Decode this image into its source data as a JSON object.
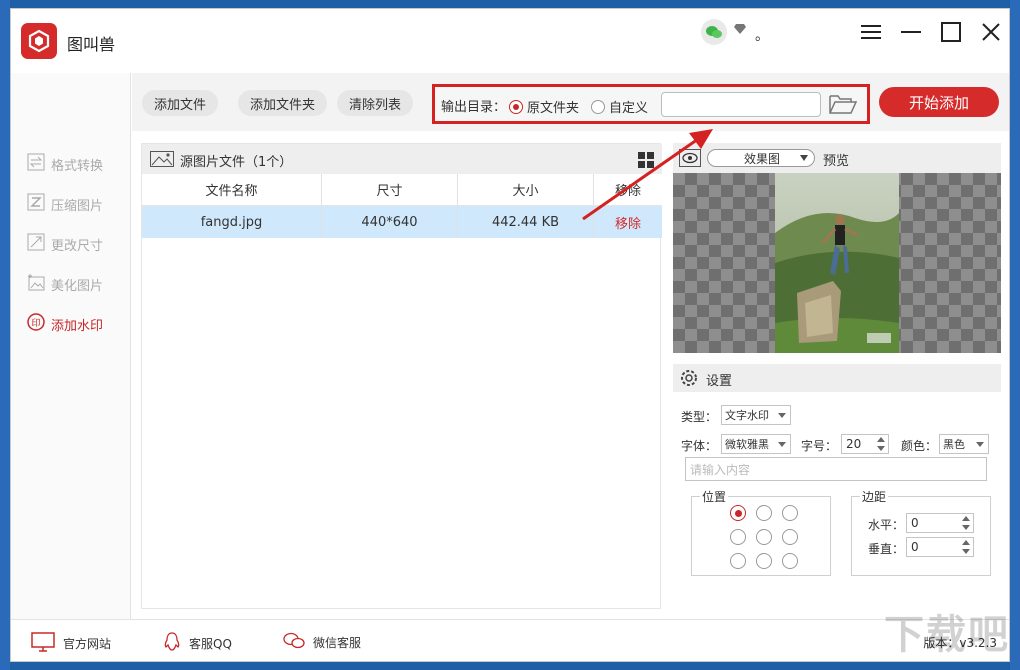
{
  "app": {
    "title": "图叫兽"
  },
  "account": {
    "suffix": "。"
  },
  "sidebar": {
    "items": [
      {
        "label": "格式转换",
        "icon": "swap-icon"
      },
      {
        "label": "压缩图片",
        "icon": "compress-icon"
      },
      {
        "label": "更改尺寸",
        "icon": "resize-icon"
      },
      {
        "label": "美化图片",
        "icon": "beautify-icon"
      },
      {
        "label": "添加水印",
        "icon": "stamp-icon",
        "active": true
      }
    ]
  },
  "toolbar": {
    "add_file": "添加文件",
    "add_folder": "添加文件夹",
    "clear_list": "清除列表",
    "output_label": "输出目录：",
    "opt_original": "原文件夹",
    "opt_custom": "自定义",
    "output_path": "",
    "start": "开始添加"
  },
  "filelist": {
    "title": "源图片文件（1个）",
    "columns": [
      "文件名称",
      "尺寸",
      "大小",
      "移除"
    ],
    "rows": [
      {
        "name": "fangd.jpg",
        "size": "440*640",
        "bytes": "442.44 KB",
        "action": "移除"
      }
    ]
  },
  "preview": {
    "mode": "效果图",
    "label": "预览"
  },
  "settings": {
    "title": "设置",
    "type_label": "类型：",
    "type_value": "文字水印",
    "font_label": "字体：",
    "font_value": "微软雅黑",
    "fontsize_label": "字号：",
    "fontsize_value": "20",
    "color_label": "颜色：",
    "color_value": "黑色",
    "content_placeholder": "请输入内容",
    "position_label": "位置",
    "margin_label": "边距",
    "horizontal_label": "水平：",
    "horizontal_value": "0",
    "vertical_label": "垂直：",
    "vertical_value": "0"
  },
  "footer": {
    "website": "官方网站",
    "qq": "客服QQ",
    "wechat": "微信客服",
    "version": "版本：v3.2.3"
  },
  "watermark_text": "下载吧",
  "colors": {
    "accent": "#d62b2b",
    "selected_row": "#cfe8fb"
  }
}
